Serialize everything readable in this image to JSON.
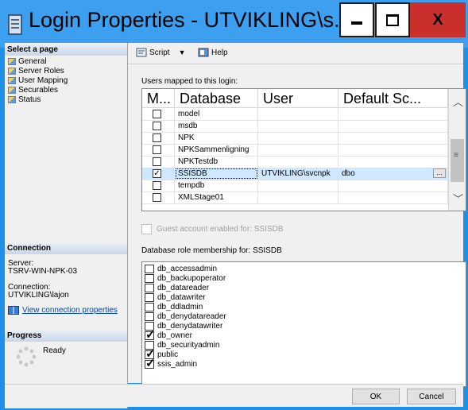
{
  "window": {
    "title": "Login Properties - UTVIKLING\\s...",
    "minimize_label": "▬",
    "maximize_label": "☐",
    "close_label": "X"
  },
  "left_panel": {
    "select_page_header": "Select a page",
    "pages": [
      {
        "label": "General"
      },
      {
        "label": "Server Roles"
      },
      {
        "label": "User Mapping"
      },
      {
        "label": "Securables"
      },
      {
        "label": "Status"
      }
    ],
    "connection_header": "Connection",
    "server_label": "Server:",
    "server_value": "TSRV-WIN-NPK-03",
    "connection_label": "Connection:",
    "connection_value": "UTVIKLING\\lajon",
    "view_link": "View connection properties",
    "progress_header": "Progress",
    "progress_status": "Ready"
  },
  "toolbar": {
    "script_label": "Script",
    "help_label": "Help"
  },
  "users_mapped": {
    "label": "Users mapped to this login:",
    "columns": [
      "M...",
      "Database",
      "User",
      "Default Sc..."
    ],
    "rows": [
      {
        "checked": false,
        "database": "model",
        "user": "",
        "schema": ""
      },
      {
        "checked": false,
        "database": "msdb",
        "user": "",
        "schema": ""
      },
      {
        "checked": false,
        "database": "NPK",
        "user": "",
        "schema": ""
      },
      {
        "checked": false,
        "database": "NPKSammenligning",
        "user": "",
        "schema": ""
      },
      {
        "checked": false,
        "database": "NPKTestdb",
        "user": "",
        "schema": ""
      },
      {
        "checked": true,
        "database": "SSISDB",
        "user": "UTVIKLING\\svcnpk",
        "schema": "dbo",
        "selected": true
      },
      {
        "checked": false,
        "database": "tempdb",
        "user": "",
        "schema": ""
      },
      {
        "checked": false,
        "database": "XMLStage01",
        "user": "",
        "schema": ""
      }
    ],
    "ellipsis_label": "..."
  },
  "guest": {
    "label": "Guest account enabled for: SSISDB"
  },
  "roles": {
    "label": "Database role membership for: SSISDB",
    "items": [
      {
        "name": "db_accessadmin",
        "checked": false
      },
      {
        "name": "db_backupoperator",
        "checked": false
      },
      {
        "name": "db_datareader",
        "checked": false
      },
      {
        "name": "db_datawriter",
        "checked": false
      },
      {
        "name": "db_ddladmin",
        "checked": false
      },
      {
        "name": "db_denydatareader",
        "checked": false
      },
      {
        "name": "db_denydatawriter",
        "checked": false
      },
      {
        "name": "db_owner",
        "checked": true
      },
      {
        "name": "db_securityadmin",
        "checked": false
      },
      {
        "name": "public",
        "checked": true
      },
      {
        "name": "ssis_admin",
        "checked": true
      }
    ]
  },
  "footer": {
    "ok_label": "OK",
    "cancel_label": "Cancel"
  },
  "colors": {
    "title_bar": "#3c9ff0",
    "close_button": "#c9302c",
    "selected_row": "#cde8ff",
    "link": "#0645ad"
  }
}
